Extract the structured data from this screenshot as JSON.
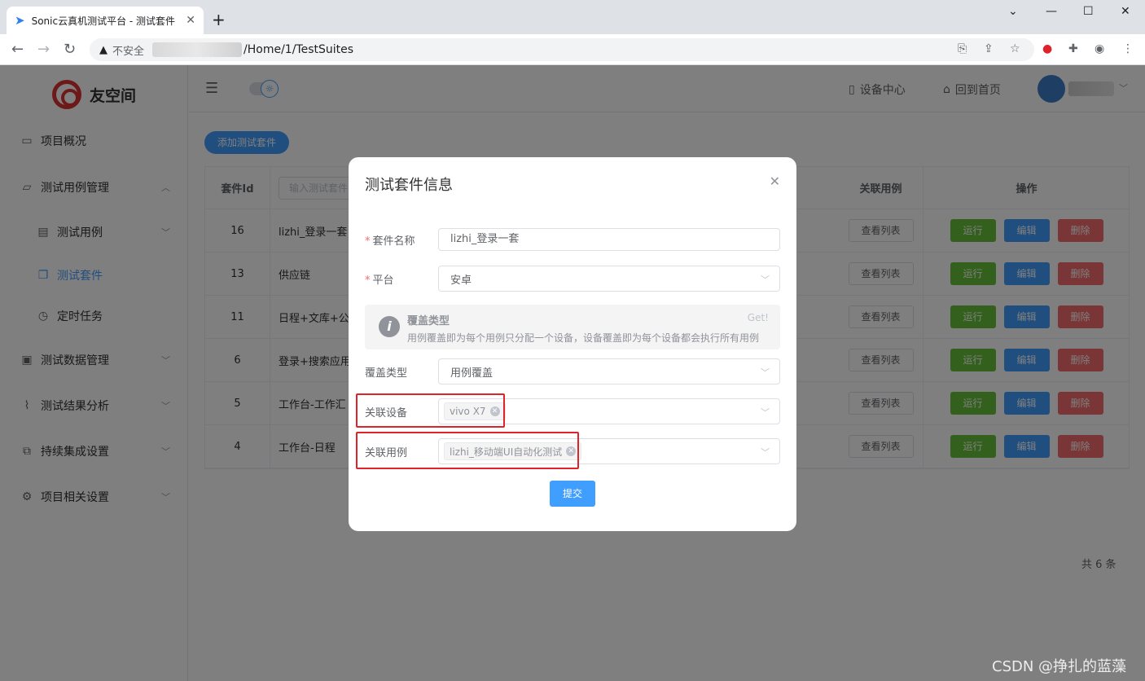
{
  "browser": {
    "tab_title": "Sonic云真机测试平台 - 测试套件",
    "insecure_label": "不安全",
    "url_path": "/Home/1/TestSuites"
  },
  "sidebar": {
    "logo_text": "友空间",
    "items": [
      {
        "label": "项目概况"
      },
      {
        "label": "测试用例管理"
      },
      {
        "label": "测试用例"
      },
      {
        "label": "测试套件"
      },
      {
        "label": "定时任务"
      },
      {
        "label": "测试数据管理"
      },
      {
        "label": "测试结果分析"
      },
      {
        "label": "持续集成设置"
      },
      {
        "label": "项目相关设置"
      }
    ]
  },
  "header": {
    "device_center": "设备中心",
    "back_home": "回到首页"
  },
  "main": {
    "add_button": "添加测试套件",
    "table": {
      "col_id": "套件Id",
      "search_placeholder": "输入测试套件",
      "col_cases": "关联用例",
      "col_ops": "操作",
      "view_list": "查看列表",
      "op_run": "运行",
      "op_edit": "编辑",
      "op_delete": "删除",
      "rows": [
        {
          "id": "16",
          "name": "lizhi_登录一套"
        },
        {
          "id": "13",
          "name": "供应链"
        },
        {
          "id": "11",
          "name": "日程+文库+公"
        },
        {
          "id": "6",
          "name": "登录+搜索应用"
        },
        {
          "id": "5",
          "name": "工作台-工作汇"
        },
        {
          "id": "4",
          "name": "工作台-日程"
        }
      ]
    },
    "total": "共 6 条"
  },
  "dialog": {
    "title": "测试套件信息",
    "suite_name_label": "套件名称",
    "suite_name_value": "lizhi_登录一套",
    "platform_label": "平台",
    "platform_value": "安卓",
    "alert_title": "覆盖类型",
    "alert_desc": "用例覆盖即为每个用例只分配一个设备，设备覆盖即为每个设备都会执行所有用例",
    "alert_link": "Get!",
    "cover_label": "覆盖类型",
    "cover_value": "用例覆盖",
    "device_label": "关联设备",
    "device_tag": "vivo X7",
    "case_label": "关联用例",
    "case_tag": "lizhi_移动端UI自动化测试",
    "submit": "提交"
  },
  "watermark": "CSDN @挣扎的蓝藻"
}
